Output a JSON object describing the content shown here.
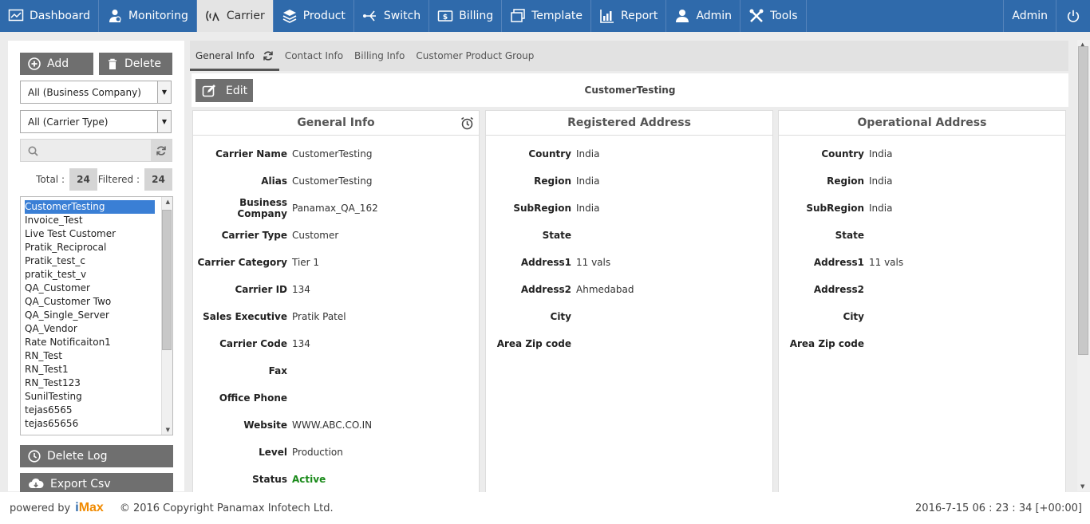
{
  "nav": {
    "items": [
      {
        "label": "Dashboard",
        "icon": "dashboard-icon"
      },
      {
        "label": "Monitoring",
        "icon": "monitoring-icon"
      },
      {
        "label": "Carrier",
        "icon": "carrier-icon",
        "active": true
      },
      {
        "label": "Product",
        "icon": "product-icon"
      },
      {
        "label": "Switch",
        "icon": "switch-icon"
      },
      {
        "label": "Billing",
        "icon": "billing-icon"
      },
      {
        "label": "Template",
        "icon": "template-icon"
      },
      {
        "label": "Report",
        "icon": "report-icon"
      },
      {
        "label": "Admin",
        "icon": "admin-icon"
      },
      {
        "label": "Tools",
        "icon": "tools-icon"
      }
    ],
    "user": "Admin"
  },
  "left": {
    "add_label": "Add",
    "delete_label": "Delete",
    "company_filter": "All (Business Company)",
    "type_filter": "All (Carrier Type)",
    "total_label": "Total :",
    "total_value": "24",
    "filtered_label": "Filtered :",
    "filtered_value": "24",
    "carriers": [
      "CustomerTesting",
      "Invoice_Test",
      "Live Test Customer",
      "Pratik_Reciprocal",
      "Pratik_test_c",
      "pratik_test_v",
      "QA_Customer",
      "QA_Customer Two",
      "QA_Single_Server",
      "QA_Vendor",
      "Rate Notificaiton1",
      "RN_Test",
      "RN_Test1",
      "RN_Test123",
      "SunilTesting",
      "tejas6565",
      "tejas65656"
    ],
    "delete_log_label": "Delete Log",
    "export_label": "Export Csv"
  },
  "tabs": [
    "General Info",
    "Contact Info",
    "Billing Info",
    "Customer Product Group"
  ],
  "edit_label": "Edit",
  "customer_title": "CustomerTesting",
  "general": {
    "title": "General Info",
    "rows": [
      {
        "k": "Carrier Name",
        "v": "CustomerTesting"
      },
      {
        "k": "Alias",
        "v": "CustomerTesting"
      },
      {
        "k": "Business Company",
        "v": "Panamax_QA_162"
      },
      {
        "k": "Carrier Type",
        "v": "Customer"
      },
      {
        "k": "Carrier Category",
        "v": "Tier 1"
      },
      {
        "k": "Carrier ID",
        "v": "134"
      },
      {
        "k": "Sales Executive",
        "v": "Pratik Patel"
      },
      {
        "k": "Carrier Code",
        "v": "134"
      },
      {
        "k": "Fax",
        "v": ""
      },
      {
        "k": "Office Phone",
        "v": ""
      },
      {
        "k": "Website",
        "v": "WWW.ABC.CO.IN"
      },
      {
        "k": "Level",
        "v": "Production"
      },
      {
        "k": "Status",
        "v": "Active"
      }
    ]
  },
  "registered": {
    "title": "Registered Address",
    "rows": [
      {
        "k": "Country",
        "v": "India"
      },
      {
        "k": "Region",
        "v": "India"
      },
      {
        "k": "SubRegion",
        "v": "India"
      },
      {
        "k": "State",
        "v": ""
      },
      {
        "k": "Address1",
        "v": "11 vals"
      },
      {
        "k": "Address2",
        "v": "Ahmedabad"
      },
      {
        "k": "City",
        "v": ""
      },
      {
        "k": "Area Zip code",
        "v": ""
      }
    ]
  },
  "operational": {
    "title": "Operational Address",
    "rows": [
      {
        "k": "Country",
        "v": "India"
      },
      {
        "k": "Region",
        "v": "India"
      },
      {
        "k": "SubRegion",
        "v": "India"
      },
      {
        "k": "State",
        "v": ""
      },
      {
        "k": "Address1",
        "v": "11 vals"
      },
      {
        "k": "Address2",
        "v": ""
      },
      {
        "k": "City",
        "v": ""
      },
      {
        "k": "Area Zip code",
        "v": ""
      }
    ]
  },
  "footer": {
    "powered": "powered by",
    "logo_a": "i",
    "logo_b": "Max",
    "copyright": "© 2016 Copyright Panamax Infotech Ltd.",
    "timestamp": "2016-7-15 06 : 23 : 34 [+00:00]"
  },
  "colors": {
    "nav": "#2f6aab",
    "button": "#6f6f6f",
    "active_status": "#1a8a1a",
    "selection": "#3a7fd5"
  }
}
